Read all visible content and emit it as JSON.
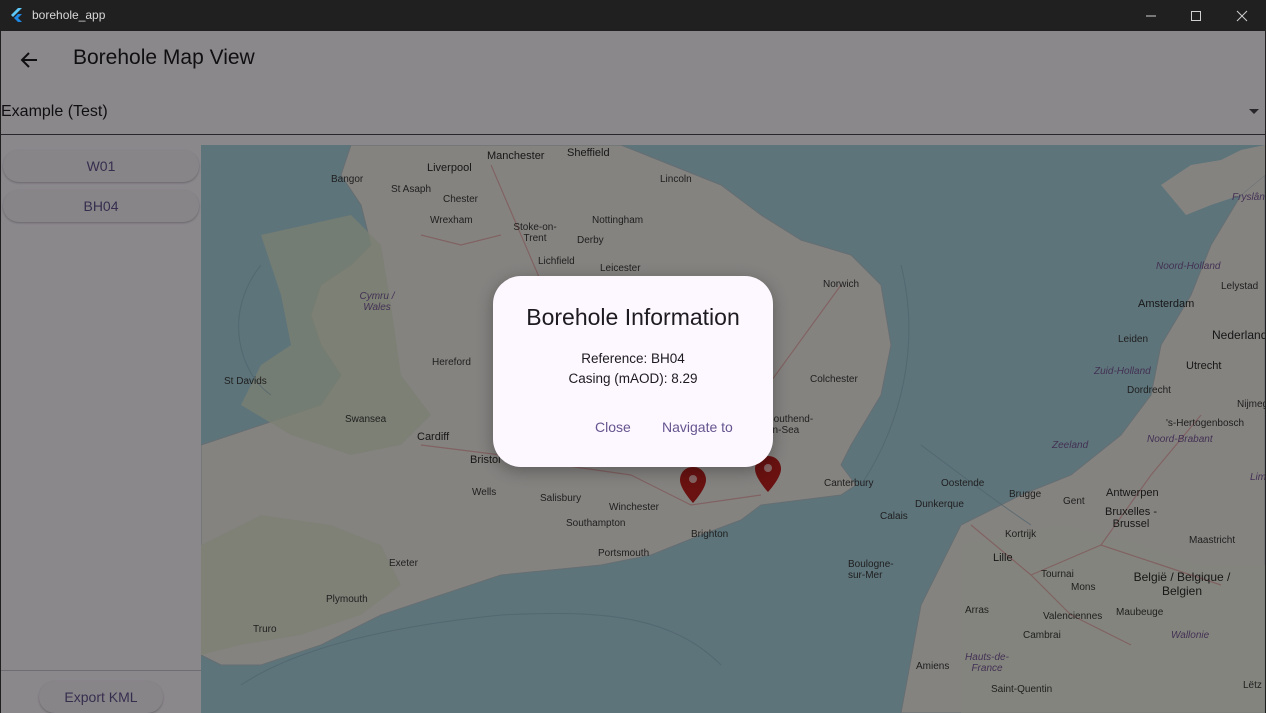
{
  "window": {
    "title": "borehole_app",
    "icons": {
      "app": "flutter-logo-icon",
      "minimize": "minimize-icon",
      "maximize": "maximize-icon",
      "close": "close-icon"
    }
  },
  "appbar": {
    "title": "Borehole Map View",
    "back_icon": "arrow-left-icon"
  },
  "dropdown": {
    "value": "Example (Test)"
  },
  "sidebar": {
    "items": [
      {
        "label": "W01"
      },
      {
        "label": "BH04"
      }
    ],
    "export_label": "Export KML"
  },
  "map": {
    "labels": {
      "manchester": "Manchester",
      "sheffield": "Sheffield",
      "liverpool": "Liverpool",
      "bangor": "Bangor",
      "st_asaph": "St Asaph",
      "chester": "Chester",
      "lincoln": "Lincoln",
      "wrexham": "Wrexham",
      "stoke": "Stoke-on-Trent",
      "nottingham": "Nottingham",
      "derby": "Derby",
      "lichfield": "Lichfield",
      "leicester": "Leicester",
      "norwich": "Norwich",
      "cymru": "Cymru / Wales",
      "hereford": "Hereford",
      "st_davids": "St Davids",
      "colchester": "Colchester",
      "swansea": "Swansea",
      "cardiff": "Cardiff",
      "southend": "Southend-on-Sea",
      "bristol": "Bristol",
      "wells": "Wells",
      "salisbury": "Salisbury",
      "winchester": "Winchester",
      "southampton": "Southampton",
      "canterbury": "Canterbury",
      "brighton": "Brighton",
      "portsmouth": "Portsmouth",
      "exeter": "Exeter",
      "plymouth": "Plymouth",
      "truro": "Truro",
      "amsterdam": "Amsterdam",
      "noord_holland": "Noord-Holland",
      "lelystad": "Lelystad",
      "leiden": "Leiden",
      "nederland": "Nederland",
      "utrecht": "Utrecht",
      "zuid_holland": "Zuid-Holland",
      "dordrecht": "Dordrecht",
      "nijmegen": "Nijmege",
      "hertogenbosch": "'s-Hertogenbosch",
      "zeeland": "Zeeland",
      "noord_brabant": "Noord-Brabant",
      "ostende": "Oostende",
      "brugge": "Brugge",
      "gent": "Gent",
      "antwerpen": "Antwerpen",
      "brussel": "Bruxelles - Brussel",
      "calais": "Calais",
      "dunkerque": "Dunkerque",
      "kortrijk": "Kortrijk",
      "lille": "Lille",
      "tournai": "Tournai",
      "mons": "Mons",
      "maubeuge": "Maubeuge",
      "maastricht": "Maastricht",
      "limb": "Limb",
      "belgie": "België / Belgique / Belgien",
      "wallonie": "Wallonie",
      "boulogne": "Boulogne-sur-Mer",
      "arras": "Arras",
      "valenciennes": "Valenciennes",
      "cambrai": "Cambrai",
      "hauts": "Hauts-de-France",
      "amiens": "Amiens",
      "saint_quentin": "Saint-Quentin",
      "flyslan": "Fryslân",
      "letz": "Lëtz"
    }
  },
  "dialog": {
    "title": "Borehole Information",
    "reference": "Reference: BH04",
    "casing": "Casing (mAOD): 8.29",
    "close_label": "Close",
    "navigate_label": "Navigate to"
  },
  "colors": {
    "accent": "#65558f",
    "marker": "#c0211f",
    "sea": "#aad3df",
    "land": "#f2efe9"
  }
}
